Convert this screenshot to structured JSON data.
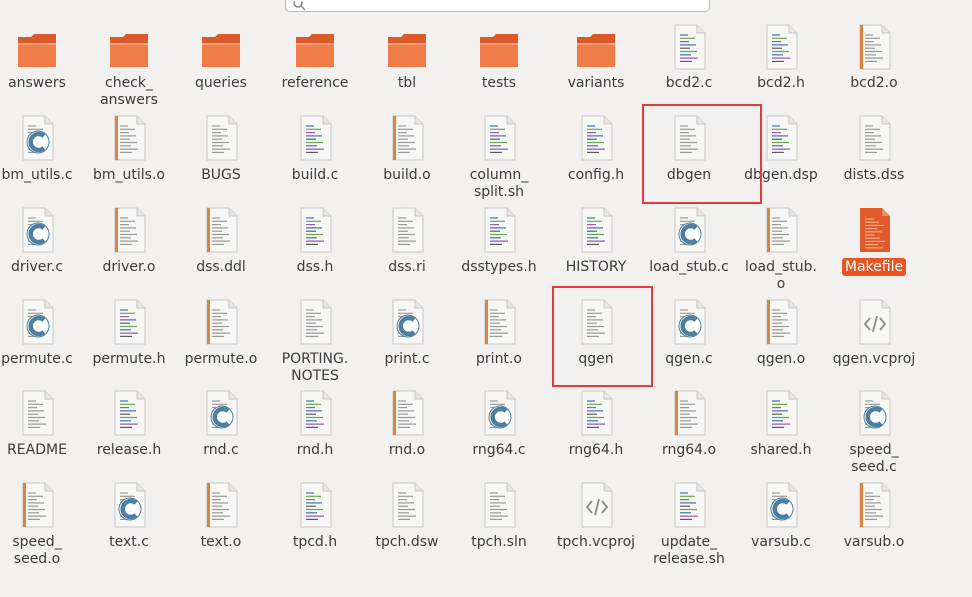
{
  "search": {
    "placeholder": ""
  },
  "colors": {
    "folder_back": "#dc5a2a",
    "folder_front": "#f07c48",
    "selection": "#e95420",
    "highlight_border": "#e23b3b",
    "c_badge": "#4f7f9f"
  },
  "files": [
    {
      "name": "answers",
      "icon": "folder-icon",
      "selected": false
    },
    {
      "name": "check_\nanswers",
      "icon": "folder-icon",
      "selected": false
    },
    {
      "name": "queries",
      "icon": "folder-icon",
      "selected": false
    },
    {
      "name": "reference",
      "icon": "folder-icon",
      "selected": false
    },
    {
      "name": "tbl",
      "icon": "folder-icon",
      "selected": false
    },
    {
      "name": "tests",
      "icon": "folder-icon",
      "selected": false
    },
    {
      "name": "variants",
      "icon": "folder-icon",
      "selected": false
    },
    {
      "name": "bcd2.c",
      "icon": "code-file-icon",
      "selected": false
    },
    {
      "name": "bcd2.h",
      "icon": "code-file-icon",
      "selected": false
    },
    {
      "name": "bcd2.o",
      "icon": "object-file-icon",
      "selected": false
    },
    {
      "name": "bm_utils.c",
      "icon": "c-source-icon",
      "selected": false
    },
    {
      "name": "bm_utils.o",
      "icon": "object-file-icon",
      "selected": false
    },
    {
      "name": "BUGS",
      "icon": "text-file-icon",
      "selected": false
    },
    {
      "name": "build.c",
      "icon": "code-file-icon",
      "selected": false
    },
    {
      "name": "build.o",
      "icon": "object-file-icon",
      "selected": false
    },
    {
      "name": "column_\nsplit.sh",
      "icon": "code-file-icon",
      "selected": false
    },
    {
      "name": "config.h",
      "icon": "code-file-icon",
      "selected": false
    },
    {
      "name": "dbgen",
      "icon": "text-file-icon",
      "selected": false
    },
    {
      "name": "dbgen.dsp",
      "icon": "code-file-icon",
      "selected": false
    },
    {
      "name": "dists.dss",
      "icon": "text-file-icon",
      "selected": false
    },
    {
      "name": "driver.c",
      "icon": "c-source-icon",
      "selected": false
    },
    {
      "name": "driver.o",
      "icon": "object-file-icon",
      "selected": false
    },
    {
      "name": "dss.ddl",
      "icon": "object-file-icon",
      "selected": false
    },
    {
      "name": "dss.h",
      "icon": "code-file-icon",
      "selected": false
    },
    {
      "name": "dss.ri",
      "icon": "text-file-icon",
      "selected": false
    },
    {
      "name": "dsstypes.h",
      "icon": "code-file-icon",
      "selected": false
    },
    {
      "name": "HISTORY",
      "icon": "code-file-icon",
      "selected": false
    },
    {
      "name": "load_stub.c",
      "icon": "c-source-icon",
      "selected": false
    },
    {
      "name": "load_stub.\no",
      "icon": "object-file-icon",
      "selected": false
    },
    {
      "name": "Makefile",
      "icon": "makefile-icon",
      "selected": true
    },
    {
      "name": "permute.c",
      "icon": "c-source-icon",
      "selected": false
    },
    {
      "name": "permute.h",
      "icon": "code-file-icon",
      "selected": false
    },
    {
      "name": "permute.o",
      "icon": "object-file-icon",
      "selected": false
    },
    {
      "name": "PORTING.\nNOTES",
      "icon": "text-file-icon",
      "selected": false
    },
    {
      "name": "print.c",
      "icon": "c-source-icon",
      "selected": false
    },
    {
      "name": "print.o",
      "icon": "object-file-icon",
      "selected": false
    },
    {
      "name": "qgen",
      "icon": "text-file-icon",
      "selected": false
    },
    {
      "name": "qgen.c",
      "icon": "c-source-icon",
      "selected": false
    },
    {
      "name": "qgen.o",
      "icon": "object-file-icon",
      "selected": false
    },
    {
      "name": "qgen.vcproj",
      "icon": "xml-file-icon",
      "selected": false
    },
    {
      "name": "README",
      "icon": "text-file-icon",
      "selected": false
    },
    {
      "name": "release.h",
      "icon": "code-file-icon",
      "selected": false
    },
    {
      "name": "rnd.c",
      "icon": "c-source-icon",
      "selected": false
    },
    {
      "name": "rnd.h",
      "icon": "code-file-icon",
      "selected": false
    },
    {
      "name": "rnd.o",
      "icon": "object-file-icon",
      "selected": false
    },
    {
      "name": "rng64.c",
      "icon": "c-source-icon",
      "selected": false
    },
    {
      "name": "rng64.h",
      "icon": "code-file-icon",
      "selected": false
    },
    {
      "name": "rng64.o",
      "icon": "object-file-icon",
      "selected": false
    },
    {
      "name": "shared.h",
      "icon": "code-file-icon",
      "selected": false
    },
    {
      "name": "speed_\nseed.c",
      "icon": "c-source-icon",
      "selected": false
    },
    {
      "name": "speed_\nseed.o",
      "icon": "object-file-icon",
      "selected": false
    },
    {
      "name": "text.c",
      "icon": "c-source-icon",
      "selected": false
    },
    {
      "name": "text.o",
      "icon": "object-file-icon",
      "selected": false
    },
    {
      "name": "tpcd.h",
      "icon": "code-file-icon",
      "selected": false
    },
    {
      "name": "tpch.dsw",
      "icon": "text-file-icon",
      "selected": false
    },
    {
      "name": "tpch.sln",
      "icon": "text-file-icon",
      "selected": false
    },
    {
      "name": "tpch.vcproj",
      "icon": "xml-file-icon",
      "selected": false
    },
    {
      "name": "update_\nrelease.sh",
      "icon": "code-file-icon",
      "selected": false
    },
    {
      "name": "varsub.c",
      "icon": "c-source-icon",
      "selected": false
    },
    {
      "name": "varsub.o",
      "icon": "object-file-icon",
      "selected": false
    }
  ],
  "highlighted": [
    "dbgen",
    "qgen"
  ]
}
